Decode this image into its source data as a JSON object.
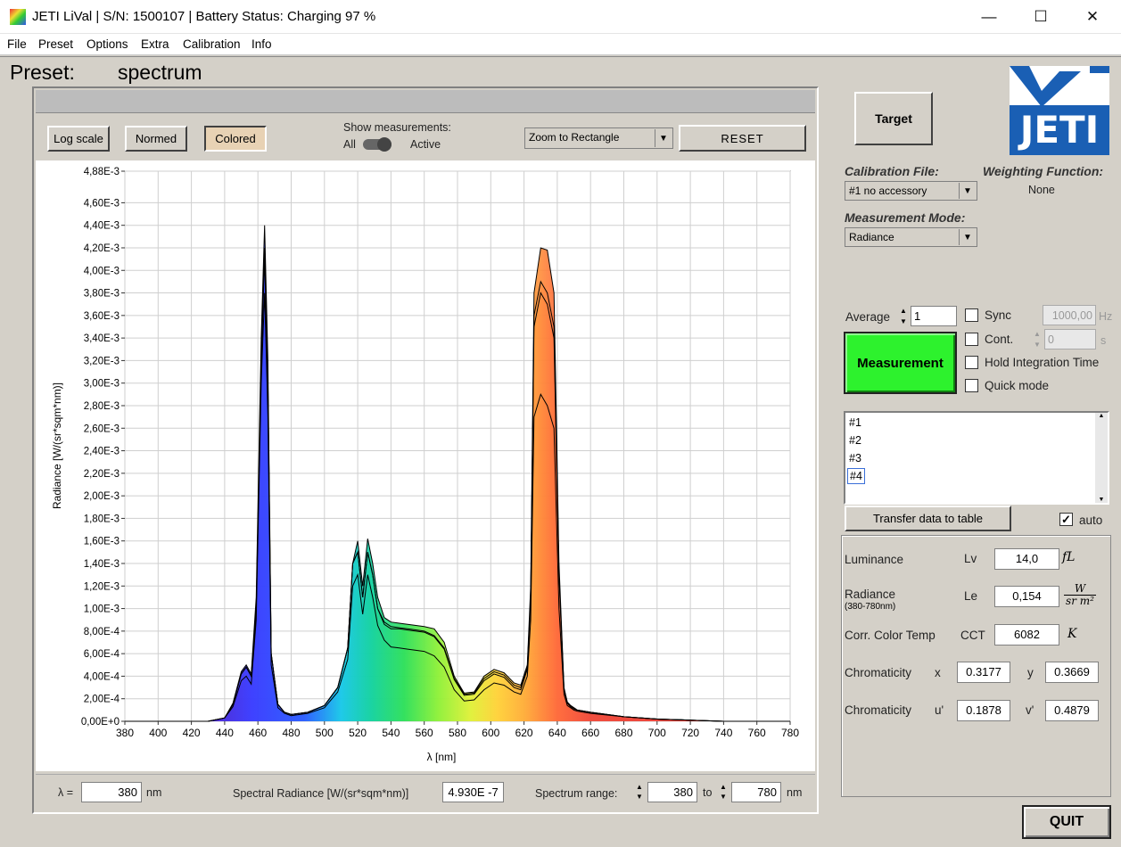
{
  "window": {
    "title": "JETI LiVal | S/N: 1500107 | Battery Status: Charging 97 %",
    "minimize": "—",
    "maximize": "☐",
    "close": "✕"
  },
  "menu": [
    "File",
    "Preset",
    "Options",
    "Extra",
    "Calibration",
    "Info"
  ],
  "preset": {
    "label": "Preset:",
    "value": "spectrum"
  },
  "toolbar": {
    "log_scale": "Log scale",
    "normed": "Normed",
    "colored": "Colored",
    "show_measurements": "Show measurements:",
    "all": "All",
    "active": "Active",
    "zoom_mode": "Zoom to Rectangle",
    "reset": "RESET"
  },
  "chart_data": {
    "type": "area",
    "xlabel": "λ [nm]",
    "ylabel": "Radiance [W/(sr*sqm*nm)]",
    "xlim": [
      380,
      780
    ],
    "ylim": [
      0,
      0.00488
    ],
    "x_ticks": [
      "380",
      "400",
      "420",
      "440",
      "460",
      "480",
      "500",
      "520",
      "540",
      "560",
      "580",
      "600",
      "620",
      "640",
      "660",
      "680",
      "700",
      "720",
      "740",
      "760",
      "780"
    ],
    "y_ticks": [
      "0,00E+0",
      "2,00E-4",
      "4,00E-4",
      "6,00E-4",
      "8,00E-4",
      "1,00E-3",
      "1,20E-3",
      "1,40E-3",
      "1,60E-3",
      "1,80E-3",
      "2,00E-3",
      "2,20E-3",
      "2,40E-3",
      "2,60E-3",
      "2,80E-3",
      "3,00E-3",
      "3,20E-3",
      "3,40E-3",
      "3,60E-3",
      "3,80E-3",
      "4,00E-3",
      "4,20E-3",
      "4,40E-3",
      "4,60E-3",
      "4,88E-3"
    ],
    "grid": true,
    "x": [
      380,
      430,
      440,
      445,
      450,
      453,
      456,
      459,
      462,
      464,
      466,
      468,
      472,
      476,
      480,
      490,
      500,
      508,
      514,
      517,
      520,
      523,
      526,
      529,
      532,
      536,
      540,
      545,
      550,
      560,
      566,
      572,
      578,
      584,
      590,
      596,
      602,
      608,
      614,
      618,
      622,
      624,
      626,
      630,
      634,
      638,
      641,
      644,
      646,
      648,
      650,
      652,
      660,
      680,
      700,
      720,
      740,
      760,
      780
    ],
    "series": [
      {
        "values": [
          0,
          0,
          3e-05,
          0.00016,
          0.00044,
          0.0005,
          0.00042,
          0.0011,
          0.0034,
          0.0044,
          0.0032,
          0.0006,
          0.00015,
          8e-05,
          6e-05,
          8e-05,
          0.00014,
          0.0003,
          0.00065,
          0.0014,
          0.0016,
          0.0012,
          0.00162,
          0.0014,
          0.0011,
          0.00092,
          0.00088,
          0.00087,
          0.00086,
          0.00084,
          0.00082,
          0.0007,
          0.0004,
          0.00025,
          0.00026,
          0.0004,
          0.00046,
          0.00043,
          0.00034,
          0.00032,
          0.0005,
          0.0012,
          0.0038,
          0.0042,
          0.00418,
          0.0038,
          0.0014,
          0.0003,
          0.00017,
          0.00014,
          0.00012,
          0.0001,
          8e-05,
          4e-05,
          2e-05,
          1e-05,
          0,
          0,
          0
        ]
      },
      {
        "values": [
          0,
          0,
          3e-05,
          0.00015,
          0.00042,
          0.00048,
          0.0004,
          0.001,
          0.0032,
          0.0042,
          0.003,
          0.0006,
          0.00015,
          8e-05,
          6e-05,
          8e-05,
          0.00014,
          0.0003,
          0.00065,
          0.0014,
          0.0015,
          0.0011,
          0.0015,
          0.0013,
          0.001,
          0.00088,
          0.00084,
          0.00083,
          0.00082,
          0.0008,
          0.00076,
          0.00065,
          0.00038,
          0.00024,
          0.00025,
          0.00038,
          0.00044,
          0.00041,
          0.00032,
          0.0003,
          0.00048,
          0.0011,
          0.0036,
          0.0039,
          0.0038,
          0.0035,
          0.0013,
          0.00029,
          0.00017,
          0.00014,
          0.00012,
          0.0001,
          8e-05,
          4e-05,
          2e-05,
          1e-05,
          0,
          0,
          0
        ]
      },
      {
        "values": [
          0,
          0,
          3e-05,
          0.00015,
          0.00042,
          0.00048,
          0.0004,
          0.001,
          0.0032,
          0.0041,
          0.003,
          0.0006,
          0.00015,
          8e-05,
          6e-05,
          8e-05,
          0.00014,
          0.0003,
          0.00065,
          0.0014,
          0.0015,
          0.0011,
          0.0015,
          0.0013,
          0.001,
          0.00086,
          0.00082,
          0.00082,
          0.00081,
          0.00079,
          0.00075,
          0.00064,
          0.00037,
          0.00023,
          0.00024,
          0.00036,
          0.00042,
          0.00039,
          0.0003,
          0.00028,
          0.00046,
          0.0011,
          0.0035,
          0.0038,
          0.0037,
          0.0034,
          0.0013,
          0.00028,
          0.00016,
          0.00013,
          0.00011,
          0.0001,
          8e-05,
          4e-05,
          2e-05,
          1e-05,
          0,
          0,
          0
        ]
      },
      {
        "values": [
          0,
          0,
          3e-05,
          0.00013,
          0.00036,
          0.0004,
          0.00033,
          0.0009,
          0.003,
          0.0038,
          0.0027,
          0.0005,
          0.00012,
          7e-05,
          5e-05,
          7e-05,
          0.00012,
          0.00026,
          0.00055,
          0.0012,
          0.0013,
          0.00095,
          0.0013,
          0.0011,
          0.00085,
          0.00072,
          0.00066,
          0.00065,
          0.00064,
          0.00062,
          0.00058,
          0.00048,
          0.00028,
          0.00018,
          0.00019,
          0.00028,
          0.00034,
          0.00032,
          0.00026,
          0.00024,
          0.0004,
          0.0009,
          0.0027,
          0.0029,
          0.0028,
          0.0026,
          0.001,
          0.00024,
          0.00014,
          0.00012,
          0.0001,
          9e-05,
          7e-05,
          4e-05,
          2e-05,
          1e-05,
          0,
          0,
          0
        ]
      }
    ]
  },
  "bottom": {
    "lambda_label": "λ =",
    "lambda_value": "380",
    "lambda_unit": "nm",
    "sr_label": "Spectral Radiance [W/(sr*sqm*nm)]",
    "sr_value": "4.930E -7",
    "range_label": "Spectrum range:",
    "range_from": "380",
    "range_to_label": "to",
    "range_to": "780",
    "range_unit": "nm"
  },
  "right": {
    "target": "Target",
    "cal_file_label": "Calibration File:",
    "cal_file_value": "#1  no accessory",
    "weighting_label": "Weighting Function:",
    "weighting_value": "None",
    "mode_label": "Measurement Mode:",
    "mode_value": "Radiance",
    "average_label": "Average",
    "average_value": "1",
    "sync_label": "Sync",
    "sync_hz": "1000,00",
    "hz": "Hz",
    "cont_label": "Cont.",
    "cont_value": "0",
    "s": "s",
    "hold_label": "Hold Integration Time",
    "quick_label": "Quick mode",
    "measurement": "Measurement",
    "list": [
      "#1",
      "#2",
      "#3",
      "#4"
    ],
    "transfer": "Transfer data to table",
    "auto": "auto",
    "luminance_label": "Luminance",
    "lv_sym": "Lv",
    "lv_value": "14,0",
    "lv_unit": "fL",
    "radiance_label": "Radiance",
    "radiance_sub": "(380-780nm)",
    "le_sym": "Le",
    "le_value": "0,154",
    "cct_label": "Corr. Color Temp",
    "cct_sym": "CCT",
    "cct_value": "6082",
    "cct_unit": "K",
    "chrom_label": "Chromaticity",
    "x_sym": "x",
    "x_value": "0.3177",
    "y_sym": "y",
    "y_value": "0.3669",
    "chrom2_label": "Chromaticity",
    "u_sym": "u'",
    "u_value": "0.1878",
    "v_sym": "v'",
    "v_value": "0.4879",
    "quit": "QUIT"
  },
  "colors": {
    "measure_green": "#2df22d",
    "colored_btn": "#e8d2b4",
    "jeti_blue": "#1a5fb4"
  }
}
